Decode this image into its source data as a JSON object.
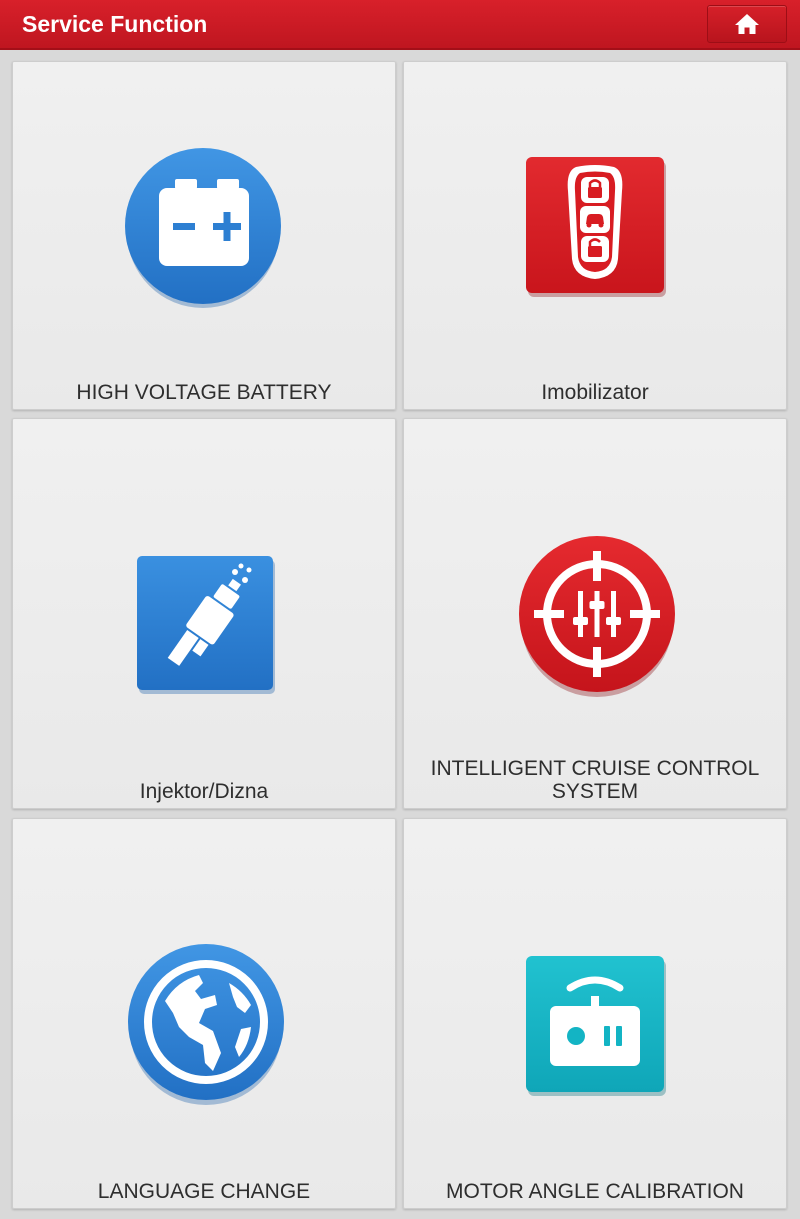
{
  "header": {
    "title": "Service Function",
    "home_icon": "home-icon"
  },
  "colors": {
    "header_red": "#c8171f",
    "blue": "#2c7fd2",
    "red": "#d81c22",
    "teal": "#13b4c4"
  },
  "tiles": [
    {
      "label": "HIGH VOLTAGE BATTERY",
      "icon": "battery-icon"
    },
    {
      "label": "Imobilizator",
      "icon": "car-key-fob-icon"
    },
    {
      "label": "Injektor/Dizna",
      "icon": "injector-icon"
    },
    {
      "label_line1": "INTELLIGENT CRUISE CONTROL",
      "label_line2": "SYSTEM",
      "icon": "cruise-control-target-icon"
    },
    {
      "label": "LANGUAGE CHANGE",
      "icon": "globe-icon"
    },
    {
      "label": "MOTOR ANGLE CALIBRATION",
      "icon": "remote-control-icon"
    }
  ]
}
